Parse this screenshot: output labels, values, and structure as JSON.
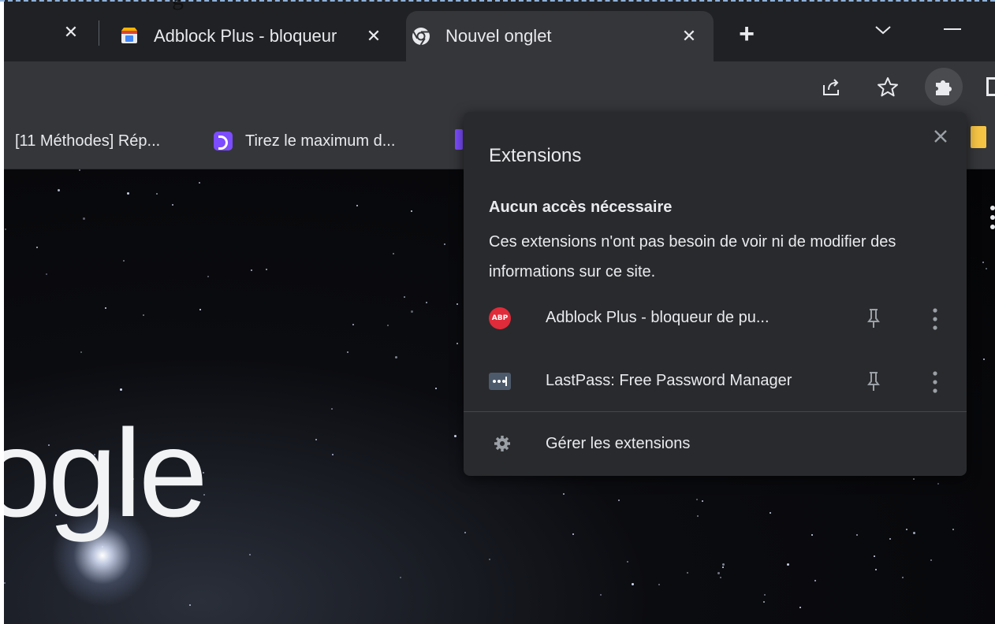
{
  "caption_snippet": "g",
  "tabs": [
    {
      "title": "Adblock Plus - bloqueur",
      "active": false
    },
    {
      "title": "Nouvel onglet",
      "active": true
    }
  ],
  "bookmarks": [
    {
      "label": "[11 Méthodes] Rép..."
    },
    {
      "label": "Tirez le maximum d..."
    }
  ],
  "page": {
    "logo_text": "ogle"
  },
  "extensions_popup": {
    "title": "Extensions",
    "section_title": "Aucun accès nécessaire",
    "section_desc": "Ces extensions n'ont pas besoin de voir ni de modifier des informations sur ce site.",
    "items": [
      {
        "name": "Adblock Plus - bloqueur de pu...",
        "icon": "abp-icon",
        "badge": "ABP"
      },
      {
        "name": "LastPass: Free Password Manager",
        "icon": "lastpass-icon"
      }
    ],
    "manage_label": "Gérer les extensions"
  },
  "colors": {
    "chrome_dark": "#202124",
    "toolbar": "#35363a",
    "popup_bg": "#292a2d",
    "text": "#e8eaed",
    "abp_red": "#e02b3a",
    "accent_purple": "#7c4dff"
  }
}
